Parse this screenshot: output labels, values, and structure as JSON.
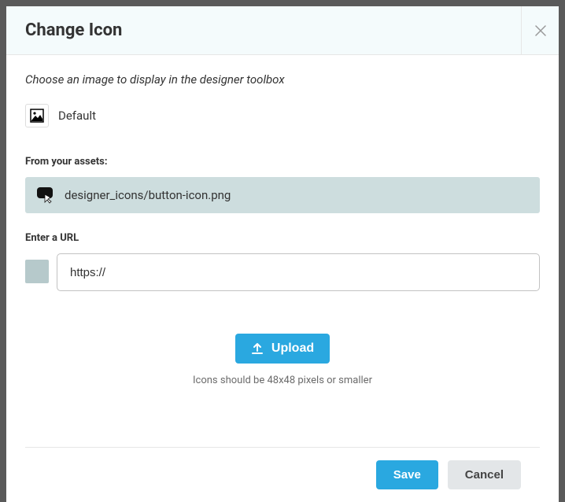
{
  "modal": {
    "title": "Change Icon",
    "instruction": "Choose an image to display in the designer toolbox",
    "default_label": "Default",
    "assets_label": "From your assets:",
    "asset_path": "designer_icons/button-icon.png",
    "url_label": "Enter a URL",
    "url_value": "https://",
    "upload_label": "Upload",
    "hint": "Icons should be 48x48 pixels or smaller",
    "save_label": "Save",
    "cancel_label": "Cancel"
  }
}
